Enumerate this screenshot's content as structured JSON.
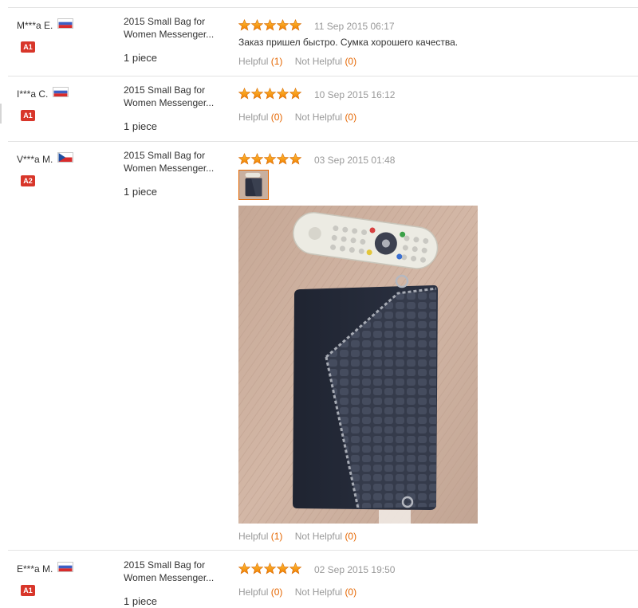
{
  "colors": {
    "accent": "#e56600",
    "star": "#ff9a00",
    "badge": "#d8362a",
    "muted": "#999999",
    "divider": "#e3e3e3"
  },
  "labels": {
    "helpful": "Helpful",
    "not_helpful": "Not Helpful"
  },
  "reviews": [
    {
      "user": "M***a E.",
      "country_flag": "russia-flag-icon",
      "level": "A1",
      "product_title_line1": "2015 Small Bag for",
      "product_title_line2": "Women Messenger...",
      "quantity": "1 piece",
      "rating": 5,
      "date": "11 Sep 2015 06:17",
      "text": "Заказ пришел быстро. Сумка хорошего качества.",
      "helpful_count": "(1)",
      "not_helpful_count": "(0)"
    },
    {
      "user": "I***a C.",
      "country_flag": "russia-flag-icon",
      "level": "A1",
      "product_title_line1": "2015 Small Bag for",
      "product_title_line2": "Women Messenger...",
      "quantity": "1 piece",
      "rating": 5,
      "date": "10 Sep 2015 16:12",
      "text": "",
      "helpful_count": "(0)",
      "not_helpful_count": "(0)"
    },
    {
      "user": "V***a M.",
      "country_flag": "czech-flag-icon",
      "level": "A2",
      "product_title_line1": "2015 Small Bag for",
      "product_title_line2": "Women Messenger...",
      "quantity": "1 piece",
      "rating": 5,
      "date": "03 Sep 2015 01:48",
      "text": "",
      "has_photo": true,
      "helpful_count": "(1)",
      "not_helpful_count": "(0)"
    },
    {
      "user": "E***a M.",
      "country_flag": "russia-flag-icon",
      "level": "A1",
      "product_title_line1": "2015 Small Bag for",
      "product_title_line2": "Women Messenger...",
      "quantity": "1 piece",
      "rating": 5,
      "date": "02 Sep 2015 19:50",
      "text": "",
      "helpful_count": "(0)",
      "not_helpful_count": "(0)"
    }
  ]
}
